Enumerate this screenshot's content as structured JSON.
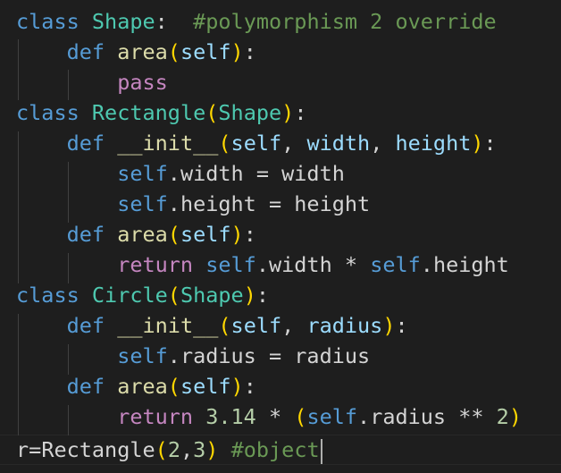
{
  "theme": {
    "background": "#1e1e1e",
    "keyword_blue": "#569cd6",
    "keyword_purple": "#c586c0",
    "class_name": "#4ec9b0",
    "function_name": "#dcdcaa",
    "parameter": "#9cdcfe",
    "comment": "#6a9955",
    "number": "#b5cea8",
    "bracket_gold": "#ffd700",
    "bracket_orchid": "#da70d6"
  },
  "code": {
    "kw_class": "class",
    "kw_def": "def",
    "kw_pass": "pass",
    "kw_return": "return",
    "self": "self",
    "shape": "Shape",
    "rectangle": "Rectangle",
    "circle": "Circle",
    "area": "area",
    "init": "__init__",
    "width": "width",
    "height": "height",
    "radius": "radius",
    "comment_polymorphism": "#polymorphism 2 override",
    "comment_object": "#object",
    "var_r": "r",
    "pi": "3.14",
    "exp": "2",
    "arg1": "2",
    "arg2": "3"
  }
}
